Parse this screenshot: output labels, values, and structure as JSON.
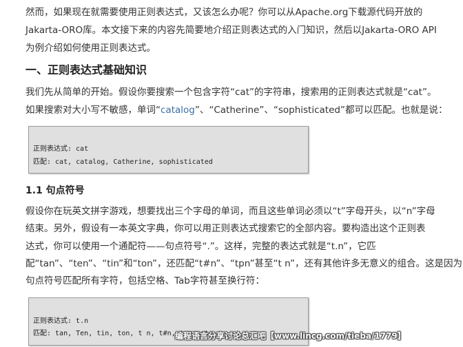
{
  "intro": {
    "line1": "然而，如果现在就需要使用正则表达式，又该怎么办呢？你可以从Apache.org下载源代码开放的",
    "line2": "Jakarta-ORO库。本文接下来的内容先简要地介绍正则表达式的入门知识，然后以Jakarta-ORO API",
    "line3": "为例介绍如何使用正则表达式。"
  },
  "section1": {
    "heading": "一、正则表达式基础知识",
    "p1_line1": "我们先从简单的开始。假设你要搜索一个包含字符“cat”的字符串，搜索用的正则表达式就是“cat”。",
    "p1_line2_a": "如果搜索对大小写不敏感，单词“",
    "p1_line2_link": "catalog",
    "p1_line2_b": "”、“Catherine”、“sophisticated”都可以匹配。也就是说：",
    "code1": {
      "line1": "正则表达式: cat",
      "line2": "匹配: cat, catalog, Catherine, sophisticated"
    }
  },
  "section11": {
    "heading": "1.1 句点符号",
    "line1": "假设你在玩英文拼字游戏，想要找出三个字母的单词，而且这些单词必须以“t”字母开头，以“n”字母",
    "line2": "结束。另外，假设有一本英文字典，你可以用正则表达式搜索它的全部内容。要构造出这个正则表",
    "line3": "达式，你可以使用一个通配符——句点符号“.”。这样，完整的表达式就是“t.n”，它匹",
    "line4": "配“tan”、“ten”、“tin”和“ton”，还匹配“t#n”、“tpn”甚至“t n”，还有其他许多无意义的组合。这是因为",
    "line5": "句点符号匹配所有字符，包括空格、Tab字符甚至换行符：",
    "code2": {
      "line1": "正则表达式: t.n",
      "line2": "匹配: tan, Ten, tin, ton, t n, t#n, tpn, etc."
    }
  },
  "watermark": "编程语言分享讨论总汇吧【www.lincg.com/tieba/1779】",
  "colors": {
    "text": "#333333",
    "link": "#3a6ea5",
    "code_bg": "#e0e0e0",
    "code_border": "#9a9a9a"
  }
}
